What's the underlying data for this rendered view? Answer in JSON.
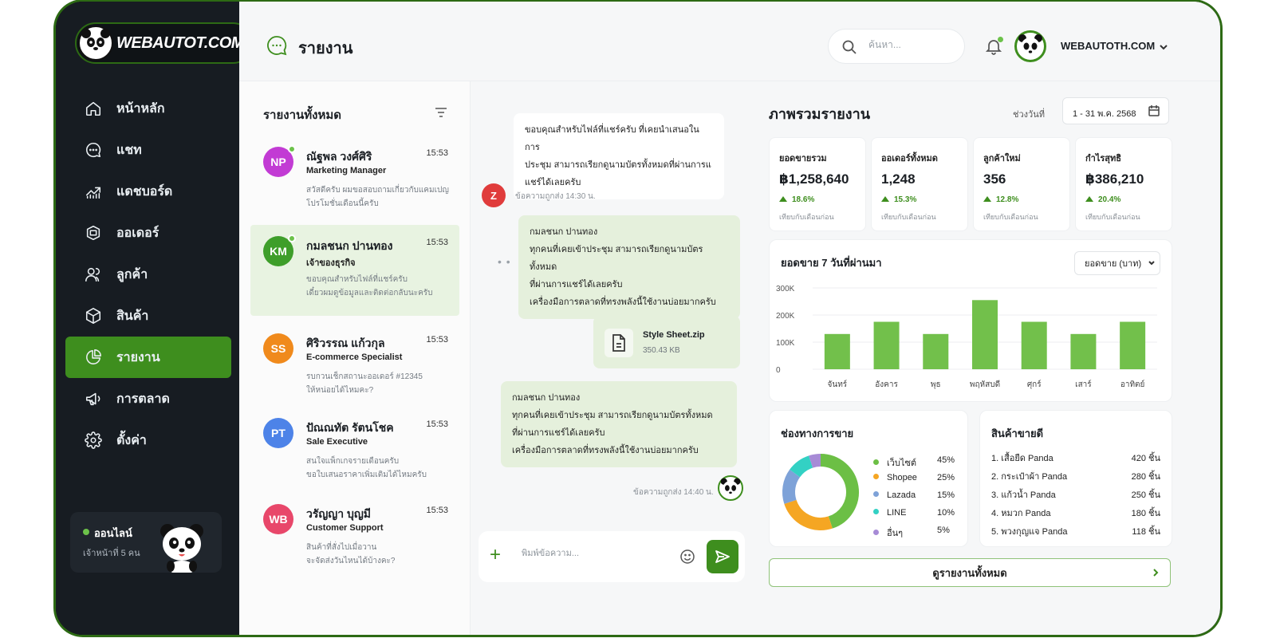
{
  "brand": {
    "logo_text": "WEBAUTOT.COM"
  },
  "header": {
    "title": "รายงาน",
    "search_placeholder": "ค้นหา...",
    "user_name": "WEBAUTOTH.COM"
  },
  "sidebar": {
    "items": [
      {
        "label": "หน้าหลัก",
        "icon": "home-icon"
      },
      {
        "label": "แชท",
        "icon": "chat-icon"
      },
      {
        "label": "แดชบอร์ด",
        "icon": "trend-icon"
      },
      {
        "label": "ออเดอร์",
        "icon": "order-icon"
      },
      {
        "label": "ลูกค้า",
        "icon": "users-icon"
      },
      {
        "label": "สินค้า",
        "icon": "box-icon"
      },
      {
        "label": "รายงาน",
        "icon": "pie-icon",
        "active": true
      },
      {
        "label": "การตลาด",
        "icon": "megaphone-icon"
      },
      {
        "label": "ตั้งค่า",
        "icon": "gear-icon"
      }
    ],
    "status": {
      "label": "ออนไลน์",
      "sub": "เจ้าหน้าที่ 5 คน"
    }
  },
  "conversations": {
    "title": "รายงานทั้งหมด",
    "items": [
      {
        "initials": "NP",
        "color": "#c23bd4",
        "online": true,
        "name": "ณัฐพล วงศ์ศิริ",
        "time": "15:53",
        "role": "Marketing Manager",
        "msg1": "สวัสดีครับ ผมขอสอบถามเกี่ยวกับแคมเปญ",
        "msg2": "โปรโมชั่นเดือนนี้ครับ"
      },
      {
        "initials": "KM",
        "color": "#3e9e2a",
        "online": true,
        "active": true,
        "name": "กมลชนก ปานทอง",
        "time": "15:53",
        "role": "เจ้าของธุรกิจ",
        "msg1": "ขอบคุณสำหรับไฟล์ที่แชร์ครับ",
        "msg2": "เดี๋ยวผมดูข้อมูลและติดต่อกลับนะครับ"
      },
      {
        "initials": "SS",
        "color": "#f08a1c",
        "online": false,
        "name": "ศิริวรรณ แก้วกุล",
        "time": "15:53",
        "role": "E-commerce Specialist",
        "msg1": "รบกวนเช็กสถานะออเดอร์ #12345",
        "msg2": "ให้หน่อยได้ไหมคะ?"
      },
      {
        "initials": "PT",
        "color": "#4d83e8",
        "online": false,
        "name": "ปัณณทัต รัตนโชค",
        "time": "15:53",
        "role": "Sale Executive",
        "msg1": "สนใจแพ็กเกจรายเดือนครับ",
        "msg2": "ขอใบเสนอราคาเพิ่มเติมได้ไหมครับ"
      },
      {
        "initials": "WB",
        "color": "#e8476a",
        "online": false,
        "name": "วรัญญา บุญมี",
        "time": "15:53",
        "role": "Customer Support",
        "msg1": "สินค้าที่สั่งไปเมื่อวาน",
        "msg2": "จะจัดส่งวันไหนได้บ้างคะ?"
      }
    ]
  },
  "chat": {
    "msg_in": [
      "ขอบคุณสำหรับไฟล์ที่แชร์ครับ ที่เคยนำเสนอในการ",
      "ประชุม สามารถเรียกดูนามบัตรทั้งหมดที่ผ่านการแ",
      "แชร์ได้เลยครับ"
    ],
    "msg_in_stamp": "ข้อความถูกส่ง 14:30 น.",
    "sender_initial": "Z",
    "typing": "• •",
    "msg_out1": [
      "กมลชนก ปานทอง",
      "ทุกคนที่เคยเข้าประชุม สามารถเรียกดูนามบัตรทั้งหมด",
      "ที่ผ่านการแชร์ได้เลยครับ",
      "เครื่องมือการตลาดที่ทรงพลังนี้ใช้งานบ่อยมากครับ"
    ],
    "file": {
      "name": "Style Sheet.zip",
      "size": "350.43 KB"
    },
    "msg_out2": [
      "กมลชนก ปานทอง",
      "ทุกคนที่เคยเข้าประชุม สามารถเรียกดูนามบัตรทั้งหมด",
      "ที่ผ่านการแชร์ได้เลยครับ",
      "เครื่องมือการตลาดที่ทรงพลังนี้ใช้งานบ่อยมากครับ"
    ],
    "msg_out_stamp": "ข้อความถูกส่ง 14:40 น.",
    "input_placeholder": "พิมพ์ข้อความ..."
  },
  "report": {
    "title": "ภาพรวมรายงาน",
    "range_label": "ช่วงวันที่",
    "range_value": "1 - 31 พ.ค. 2568",
    "kpis": [
      {
        "label": "ยอดขายรวม",
        "value": "฿1,258,640",
        "delta": "18.6%",
        "note": "เทียบกับเดือนก่อน"
      },
      {
        "label": "ออเดอร์ทั้งหมด",
        "value": "1,248",
        "delta": "15.3%",
        "note": "เทียบกับเดือนก่อน"
      },
      {
        "label": "ลูกค้าใหม่",
        "value": "356",
        "delta": "12.8%",
        "note": "เทียบกับเดือนก่อน"
      },
      {
        "label": "กำไรสุทธิ",
        "value": "฿386,210",
        "delta": "20.4%",
        "note": "เทียบกับเดือนก่อน"
      }
    ],
    "sales_title": "ยอดขาย 7 วันที่ผ่านมา",
    "sales_select": "ยอดขาย (บาท)",
    "channels_title": "ช่องทางการขาย",
    "top_title": "สินค้าขายดี",
    "top_products": [
      {
        "rank": "1.",
        "name": "เสื้อยืด Panda",
        "qty": "420 ชิ้น"
      },
      {
        "rank": "2.",
        "name": "กระเป๋าผ้า Panda",
        "qty": "280 ชิ้น"
      },
      {
        "rank": "3.",
        "name": "แก้วน้ำ Panda",
        "qty": "250 ชิ้น"
      },
      {
        "rank": "4.",
        "name": "หมวก Panda",
        "qty": "180 ชิ้น"
      },
      {
        "rank": "5.",
        "name": "พวงกุญแจ Panda",
        "qty": "118 ชิ้น"
      }
    ],
    "view_all": "ดูรายงานทั้งหมด"
  },
  "colors": {
    "accent": "#3e8e1e",
    "bar": "#72c04b",
    "sidebar": "#171c22"
  },
  "chart_data": [
    {
      "type": "bar",
      "title": "ยอดขาย 7 วันที่ผ่านมา",
      "categories": [
        "จันทร์",
        "อังคาร",
        "พุธ",
        "พฤหัสบดี",
        "ศุกร์",
        "เสาร์",
        "อาทิตย์"
      ],
      "values": [
        130000,
        175000,
        130000,
        255000,
        175000,
        130000,
        175000
      ],
      "ylim": [
        0,
        300000
      ],
      "yticks": [
        "300K",
        "200K",
        "100K",
        "0"
      ],
      "grid": true
    },
    {
      "type": "pie",
      "title": "ช่องทางการขาย",
      "series": [
        {
          "name": "เว็บไซต์",
          "value": 45,
          "label": "45%",
          "color": "#6cbf45"
        },
        {
          "name": "Shopee",
          "value": 25,
          "label": "25%",
          "color": "#f5a623"
        },
        {
          "name": "Lazada",
          "value": 15,
          "label": "15%",
          "color": "#7ea2d8"
        },
        {
          "name": "LINE",
          "value": 10,
          "label": "10%",
          "color": "#33d1c4"
        },
        {
          "name": "อื่นๆ",
          "value": 5,
          "label": "5%",
          "color": "#a78bd6"
        }
      ]
    }
  ]
}
